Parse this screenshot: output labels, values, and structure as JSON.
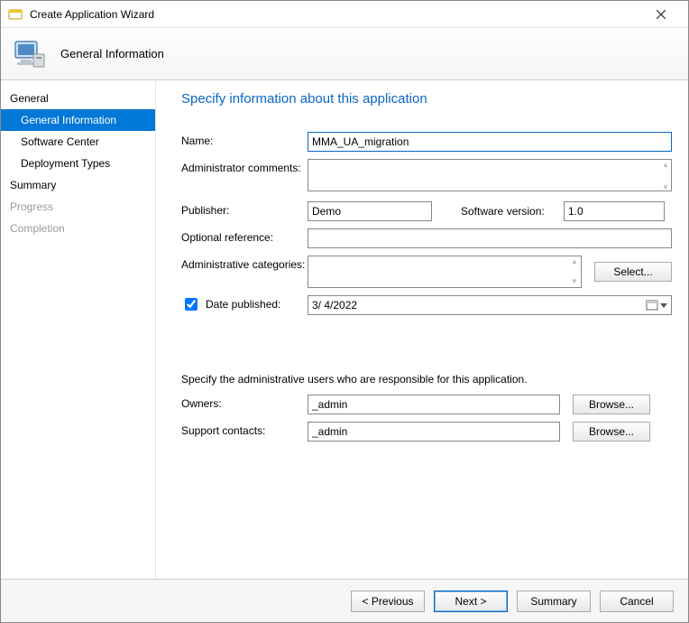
{
  "window": {
    "title": "Create Application Wizard"
  },
  "banner": {
    "title": "General Information"
  },
  "sidebar": {
    "items": [
      {
        "label": "General",
        "level": "top"
      },
      {
        "label": "General Information",
        "level": "sub",
        "selected": true
      },
      {
        "label": "Software Center",
        "level": "sub"
      },
      {
        "label": "Deployment Types",
        "level": "sub"
      },
      {
        "label": "Summary",
        "level": "top"
      },
      {
        "label": "Progress",
        "level": "top",
        "disabled": true
      },
      {
        "label": "Completion",
        "level": "top",
        "disabled": true
      }
    ]
  },
  "main": {
    "heading": "Specify information about this application",
    "labels": {
      "name": "Name:",
      "admin_comments": "Administrator comments:",
      "publisher": "Publisher:",
      "software_version": "Software version:",
      "optional_reference": "Optional reference:",
      "admin_categories": "Administrative categories:",
      "date_published": "Date published:",
      "section_responsible": "Specify the administrative users who are responsible for this application.",
      "owners": "Owners:",
      "support_contacts": "Support contacts:"
    },
    "values": {
      "name": "MMA_UA_migration",
      "admin_comments": "",
      "publisher": "Demo",
      "software_version": "1.0",
      "optional_reference": "",
      "admin_categories": "",
      "date_published_checked": true,
      "date_published": "3/  4/2022",
      "owners": "_admin",
      "support_contacts": "_admin"
    },
    "buttons": {
      "select": "Select...",
      "browse": "Browse..."
    }
  },
  "footer": {
    "previous": "< Previous",
    "next": "Next >",
    "summary": "Summary",
    "cancel": "Cancel"
  }
}
